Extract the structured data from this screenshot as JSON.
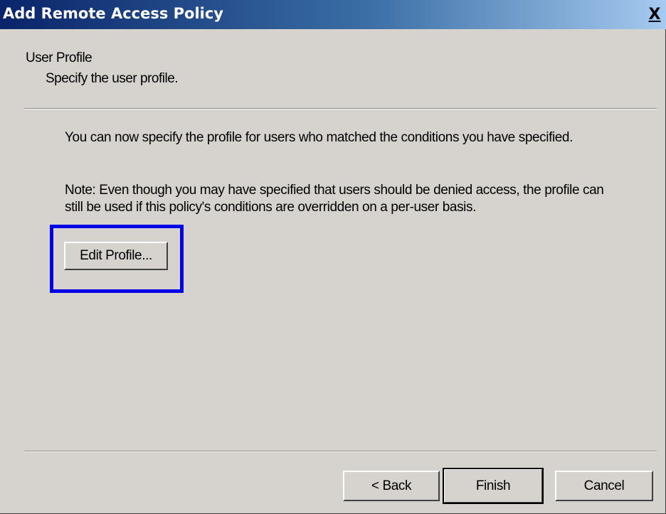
{
  "window": {
    "title": "Add Remote Access Policy",
    "close_glyph": "X"
  },
  "header": {
    "title": "User Profile",
    "subtitle": "Specify the user profile."
  },
  "content": {
    "paragraph1": "You can now specify the profile for users who matched the conditions you have specified.",
    "paragraph2": "Note: Even though you may have specified that users should be denied access, the profile can still be used if this policy's conditions are overridden on a per-user basis.",
    "edit_profile_label": "Edit Profile..."
  },
  "footer": {
    "back_label": "< Back",
    "finish_label": "Finish",
    "cancel_label": "Cancel"
  },
  "colors": {
    "dialog_background": "#d6d3ce",
    "titlebar_start": "#0a246a",
    "titlebar_end": "#a6caf0",
    "highlight_border": "#0000e6"
  }
}
